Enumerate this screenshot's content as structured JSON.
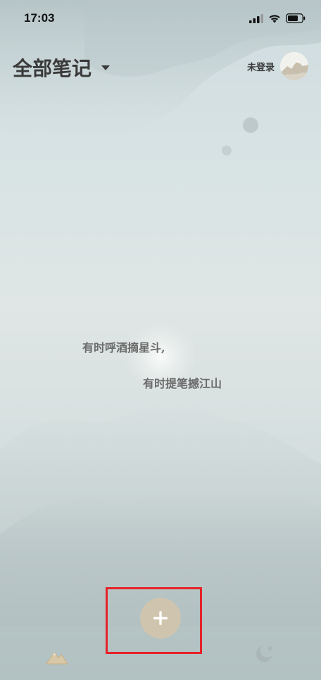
{
  "status_bar": {
    "time": "17:03",
    "signal_icon": "cellular-signal-icon",
    "wifi_icon": "wifi-icon",
    "battery_icon": "battery-icon"
  },
  "header": {
    "title": "全部笔记",
    "title_dropdown_icon": "caret-down-icon",
    "login_label": "未登录",
    "avatar_icon": "mountain-avatar-icon"
  },
  "poem": {
    "line1": "有时呼酒摘星斗,",
    "line2": "有时提笔撼江山"
  },
  "actions": {
    "add_label": "+",
    "add_icon": "plus-icon"
  },
  "bottom_nav": {
    "left_icon": "mountain-icon",
    "right_icon": "moon-icon"
  },
  "colors": {
    "add_button": "#cfc4ad",
    "highlight": "#e52228",
    "text": "#3a3a3a"
  }
}
